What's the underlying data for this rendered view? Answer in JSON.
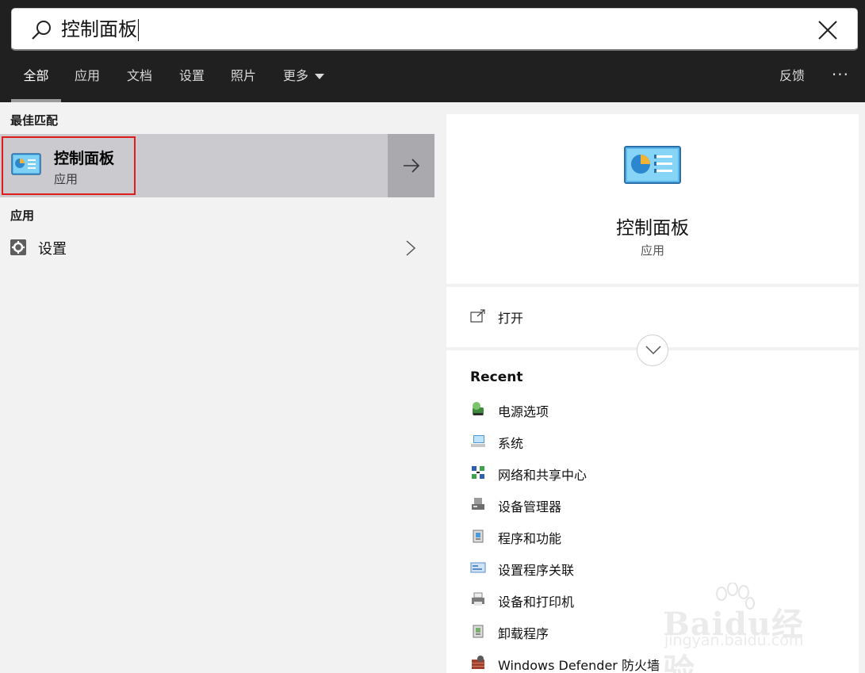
{
  "search": {
    "query": "控制面板"
  },
  "tabs": [
    {
      "label": "全部",
      "active": true
    },
    {
      "label": "应用"
    },
    {
      "label": "文档"
    },
    {
      "label": "设置"
    },
    {
      "label": "照片"
    },
    {
      "label": "更多"
    }
  ],
  "header_actions": {
    "feedback": "反馈",
    "more": "···"
  },
  "left": {
    "best_match_heading": "最佳匹配",
    "best_match": {
      "title": "控制面板",
      "subtitle": "应用",
      "icon": "control-panel-icon"
    },
    "apps_heading": "应用",
    "apps": [
      {
        "label": "设置",
        "icon": "gear-icon"
      }
    ]
  },
  "right": {
    "title": "控制面板",
    "subtitle": "应用",
    "actions": [
      {
        "label": "打开",
        "icon": "open-icon"
      }
    ],
    "recent_heading": "Recent",
    "recent": [
      {
        "label": "电源选项",
        "icon": "power-options-icon",
        "color": "#3f8a3c"
      },
      {
        "label": "系统",
        "icon": "system-icon",
        "color": "#4f9ad6"
      },
      {
        "label": "网络和共享中心",
        "icon": "network-icon",
        "color": "#2f5fb3"
      },
      {
        "label": "设备管理器",
        "icon": "device-manager-icon",
        "color": "#6d6d6d"
      },
      {
        "label": "程序和功能",
        "icon": "programs-icon",
        "color": "#8a8a8a"
      },
      {
        "label": "设置程序关联",
        "icon": "default-programs-icon",
        "color": "#5b8ec9"
      },
      {
        "label": "设备和打印机",
        "icon": "printer-icon",
        "color": "#7b7b7b"
      },
      {
        "label": "卸载程序",
        "icon": "uninstall-icon",
        "color": "#8a8a8a"
      },
      {
        "label": "Windows Defender 防火墙",
        "icon": "firewall-icon",
        "color": "#a0412d"
      }
    ]
  },
  "watermark": {
    "brand": "Baidu经验",
    "site": "jingyan.baidu.com"
  },
  "colors": {
    "highlight_border": "#e01b1b",
    "selected_bg": "#cacacf"
  }
}
